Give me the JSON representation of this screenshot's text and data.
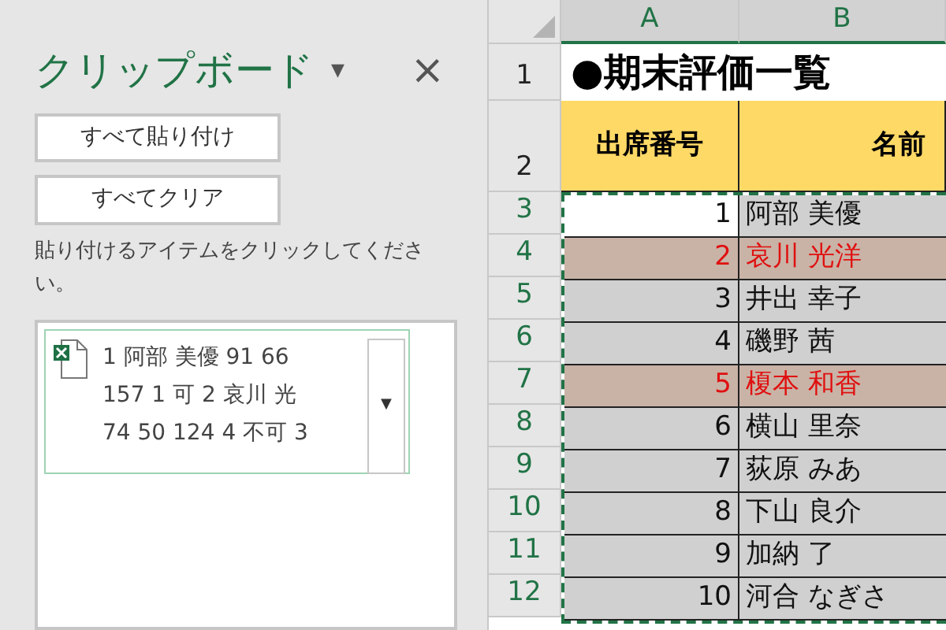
{
  "clipboard_pane": {
    "title": "クリップボード",
    "menu_glyph": "▼",
    "close_glyph": "×",
    "buttons": [
      "すべて貼り付け",
      "すべてクリア"
    ],
    "instruction": "貼り付けるアイテムをクリックしてください。",
    "items": [
      {
        "lines": [
          "1 阿部 美優 91 66",
          "157 1 可 2 哀川 光",
          "74 50 124 4 不可 3"
        ],
        "dropdown_glyph": "▼"
      }
    ]
  },
  "sheet": {
    "columns": [
      {
        "label": "A",
        "selected": true
      },
      {
        "label": "B",
        "selected": true
      }
    ],
    "title_row": {
      "number": "1",
      "text": "●期末評価一覧"
    },
    "header_row": {
      "number": "2",
      "cells": [
        "出席番号",
        "名前"
      ]
    },
    "rows": [
      {
        "number": "3",
        "id": "1",
        "name": "阿部 美優",
        "highlighted": false,
        "active": true
      },
      {
        "number": "4",
        "id": "2",
        "name": "哀川 光洋",
        "highlighted": true,
        "active": false
      },
      {
        "number": "5",
        "id": "3",
        "name": "井出 幸子",
        "highlighted": false,
        "active": false
      },
      {
        "number": "6",
        "id": "4",
        "name": "磯野 茜",
        "highlighted": false,
        "active": false
      },
      {
        "number": "7",
        "id": "5",
        "name": "榎本 和香",
        "highlighted": true,
        "active": false
      },
      {
        "number": "8",
        "id": "6",
        "name": "横山 里奈",
        "highlighted": false,
        "active": false
      },
      {
        "number": "9",
        "id": "7",
        "name": "荻原 みあ",
        "highlighted": false,
        "active": false
      },
      {
        "number": "10",
        "id": "8",
        "name": "下山 良介",
        "highlighted": false,
        "active": false
      },
      {
        "number": "11",
        "id": "9",
        "name": "加納 了",
        "highlighted": false,
        "active": false
      },
      {
        "number": "12",
        "id": "10",
        "name": "河合 なぎさ",
        "highlighted": false,
        "active": false
      }
    ]
  }
}
